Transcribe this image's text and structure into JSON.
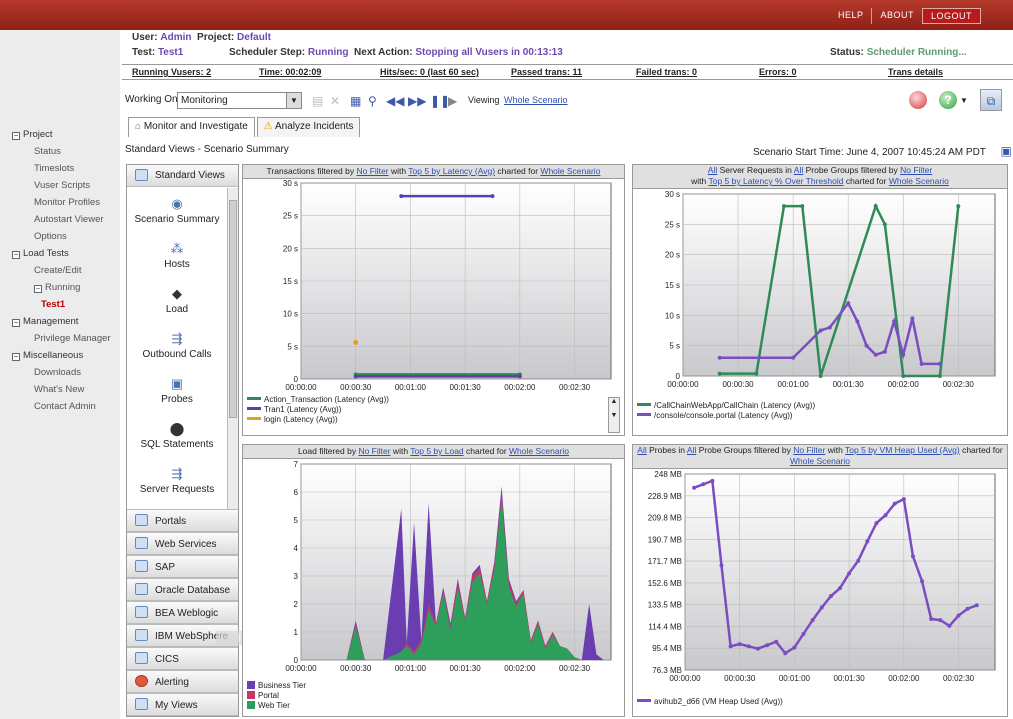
{
  "topbar": {
    "help": "HELP",
    "about": "ABOUT",
    "logout": "LOGOUT"
  },
  "header": {
    "user_label": "User:",
    "user": "Admin",
    "project_label": "Project:",
    "project": "Default",
    "test_label": "Test:",
    "test": "Test1",
    "sched_label": "Scheduler Step:",
    "sched": "Running",
    "next_label": "Next Action:",
    "next": "Stopping all Vusers in 00:13:13",
    "status_label": "Status:",
    "status": "Scheduler Running..."
  },
  "stats": {
    "running_vusers": "Running Vusers: 2",
    "time": "Time: 00:02:09",
    "hits": "Hits/sec: 0 (last 60 sec)",
    "passed": "Passed trans: 11",
    "failed": "Failed trans: 0",
    "errors": "Errors: 0",
    "trans_details": "Trans details"
  },
  "nav": [
    {
      "label": "Project",
      "level": 0,
      "box": "−"
    },
    {
      "label": "Status",
      "level": 1
    },
    {
      "label": "Timeslots",
      "level": 1
    },
    {
      "label": "Vuser Scripts",
      "level": 1
    },
    {
      "label": "Monitor Profiles",
      "level": 1
    },
    {
      "label": "Autostart Viewer",
      "level": 1
    },
    {
      "label": "Options",
      "level": 1
    },
    {
      "label": "Load Tests",
      "level": 0,
      "box": "−"
    },
    {
      "label": "Create/Edit",
      "level": 1
    },
    {
      "label": "Running",
      "level": 1,
      "box": "−"
    },
    {
      "label": "Test1",
      "level": 2
    },
    {
      "label": "Management",
      "level": 0,
      "box": "−"
    },
    {
      "label": "Privilege Manager",
      "level": 1
    },
    {
      "label": "Miscellaneous",
      "level": 0,
      "box": "−"
    },
    {
      "label": "Downloads",
      "level": 1
    },
    {
      "label": "What's New",
      "level": 1
    },
    {
      "label": "Contact Admin",
      "level": 1
    }
  ],
  "toolbar": {
    "working_on_label": "Working On:",
    "working_on": "Monitoring",
    "viewing_label": "Viewing",
    "viewing": "Whole Scenario"
  },
  "tabs": {
    "monitor": "Monitor and Investigate",
    "analyze": "Analyze Incidents"
  },
  "crumb": "Standard Views - Scenario Summary",
  "scenario_start": "Scenario Start Time:  June 4, 2007 10:45:24 AM PDT",
  "left_views": {
    "header": "Standard Views",
    "items": [
      "Scenario Summary",
      "Hosts",
      "Load",
      "Outbound Calls",
      "Probes",
      "SQL Statements",
      "Server Requests"
    ],
    "lower": [
      "Portals",
      "Web Services",
      "SAP",
      "Oracle Database",
      "BEA Weblogic",
      "IBM WebSphere",
      "CICS",
      "Alerting",
      "My Views"
    ],
    "tooltip": "Point"
  },
  "panels": {
    "p1": {
      "t1": "Transactions filtered by ",
      "l1": "No Filter",
      "t2": " with ",
      "l2": "Top 5 by Latency (Avg)",
      "t3": " charted for ",
      "l3": "Whole Scenario"
    },
    "p2": {
      "l0": "All",
      "t0": " Server Requests in ",
      "l1": "All",
      "t1": " Probe Groups filtered by ",
      "l2": "No Filter",
      "t2": "with ",
      "l3": "Top 5 by Latency % Over Threshold",
      "t3": " charted for ",
      "l4": "Whole Scenario"
    },
    "p3": {
      "t1": "Load filtered by ",
      "l1": "No Filter",
      "t2": " with ",
      "l2": "Top 5 by Load",
      "t3": " charted for ",
      "l3": "Whole Scenario"
    },
    "p4": {
      "l0": "All",
      "t0": " Probes in ",
      "l1": "All",
      "t1": " Probe Groups filtered by ",
      "l2": "No Filter",
      "t2": " with ",
      "l3": "Top 5 by VM Heap Used (Avg)",
      "t3": " charted for ",
      "l4": "Whole Scenario"
    }
  },
  "chart_data": [
    {
      "type": "line",
      "x_ticks": [
        "00:00:00",
        "00:00:30",
        "00:01:00",
        "00:01:30",
        "00:02:00",
        "00:02:30"
      ],
      "y_ticks": [
        "0",
        "5 s",
        "10 s",
        "15 s",
        "20 s",
        "25 s",
        "30 s"
      ],
      "ylim": [
        0,
        30
      ],
      "xlim": [
        0,
        170
      ],
      "series": [
        {
          "name": "Action_Transaction (Latency (Avg))",
          "color": "#2e8b57",
          "x": [
            30,
            120
          ],
          "y": [
            0.7,
            0.7
          ]
        },
        {
          "name": "Tran1 (Latency (Avg))",
          "color": "#5b3fae",
          "x": [
            55,
            105
          ],
          "y": [
            28,
            28
          ],
          "x2": [
            30,
            120
          ],
          "y2": [
            0.4,
            0.4
          ]
        },
        {
          "name": "login (Latency (Avg))",
          "color": "#e0a020",
          "x": [
            30
          ],
          "y": [
            5.6
          ]
        }
      ]
    },
    {
      "type": "line",
      "x_ticks": [
        "00:00:00",
        "00:00:30",
        "00:01:00",
        "00:01:30",
        "00:02:00",
        "00:02:30"
      ],
      "y_ticks": [
        "0",
        "5 s",
        "10 s",
        "15 s",
        "20 s",
        "25 s",
        "30 s"
      ],
      "ylim": [
        0,
        30
      ],
      "xlim": [
        0,
        170
      ],
      "series": [
        {
          "name": "/CallChainWebApp/CallChain (Latency (Avg))",
          "color": "#2e8b57",
          "x": [
            20,
            40,
            55,
            65,
            75,
            105,
            110,
            120,
            140,
            150
          ],
          "y": [
            0.4,
            0.4,
            28,
            28,
            0,
            28,
            25,
            0,
            0,
            28
          ]
        },
        {
          "name": "/console/console.portal (Latency (Avg))",
          "color": "#7b4dc0",
          "x": [
            20,
            60,
            75,
            80,
            90,
            95,
            100,
            105,
            110,
            115,
            120,
            125,
            130,
            140
          ],
          "y": [
            3,
            3,
            7.5,
            8,
            12,
            9,
            5,
            3.5,
            4,
            9,
            3.5,
            9.5,
            2,
            2
          ]
        }
      ]
    },
    {
      "type": "area",
      "x_ticks": [
        "00:00:00",
        "00:00:30",
        "00:01:00",
        "00:01:30",
        "00:02:00",
        "00:02:30"
      ],
      "y_ticks": [
        "0",
        "1",
        "2",
        "3",
        "4",
        "5",
        "6",
        "7"
      ],
      "ylim": [
        0,
        7
      ],
      "xlim": [
        0,
        170
      ],
      "series": [
        {
          "name": "Business Tier",
          "color": "#6a3db0"
        },
        {
          "name": "Portal",
          "color": "#c0396a"
        },
        {
          "name": "Web Tier",
          "color": "#2e9e5b"
        }
      ],
      "x": [
        0,
        25,
        30,
        35,
        45,
        55,
        58,
        62,
        66,
        70,
        74,
        78,
        82,
        86,
        90,
        94,
        98,
        102,
        106,
        110,
        114,
        118,
        122,
        126,
        130,
        134,
        138,
        142,
        146,
        150,
        154,
        158,
        162,
        166
      ],
      "web": [
        0,
        0,
        1.2,
        0,
        0,
        0.3,
        0.5,
        0.2,
        0.6,
        1.8,
        1.2,
        2.4,
        1.1,
        2.6,
        1.4,
        2.8,
        3.1,
        2.0,
        3.2,
        5.8,
        2.6,
        1.9,
        2.4,
        0.6,
        1.3,
        0.4,
        0.9,
        0.5,
        0.4,
        0.1,
        0,
        0,
        0,
        0
      ],
      "portal": [
        0,
        0,
        1.3,
        0,
        0,
        0.3,
        0.6,
        0.3,
        0.7,
        2.0,
        1.3,
        2.5,
        1.2,
        2.8,
        1.5,
        3.0,
        3.3,
        2.1,
        3.4,
        6.0,
        2.8,
        2.0,
        2.5,
        0.7,
        1.4,
        0.5,
        1.0,
        0.5,
        0.4,
        0.1,
        0,
        0,
        0,
        0
      ],
      "business": [
        0,
        0,
        1.4,
        0,
        0,
        5.4,
        0.6,
        4.9,
        0.7,
        5.6,
        1.3,
        2.6,
        1.3,
        2.9,
        1.5,
        3.1,
        3.4,
        2.1,
        3.5,
        6.2,
        2.9,
        2.1,
        2.5,
        0.7,
        1.4,
        0.5,
        1.0,
        0.5,
        0.4,
        0.1,
        0,
        2.0,
        0.2,
        0
      ]
    },
    {
      "type": "line",
      "x_ticks": [
        "00:00:00",
        "00:00:30",
        "00:01:00",
        "00:01:30",
        "00:02:00",
        "00:02:30"
      ],
      "y_ticks": [
        "76.3 MB",
        "95.4 MB",
        "114.4 MB",
        "133.5 MB",
        "152.6 MB",
        "171.7 MB",
        "190.7 MB",
        "209.8 MB",
        "228.9 MB",
        "248 MB"
      ],
      "ylim": [
        76.3,
        248
      ],
      "xlim": [
        0,
        170
      ],
      "series": [
        {
          "name": "avihub2_d66 (VM Heap Used (Avg))",
          "color": "#7b4dc0",
          "x": [
            5,
            10,
            15,
            20,
            25,
            30,
            35,
            40,
            45,
            50,
            55,
            60,
            65,
            70,
            75,
            80,
            85,
            90,
            95,
            100,
            105,
            110,
            115,
            120,
            125,
            130,
            135,
            140,
            145,
            150,
            155,
            160
          ],
          "y": [
            236,
            239,
            242,
            168,
            97,
            99,
            97,
            95,
            98,
            101,
            91,
            96,
            108,
            120,
            131,
            141,
            148,
            161,
            172,
            189,
            205,
            212,
            222,
            226,
            176,
            154,
            121,
            120,
            115,
            124,
            130,
            133
          ]
        }
      ]
    }
  ]
}
